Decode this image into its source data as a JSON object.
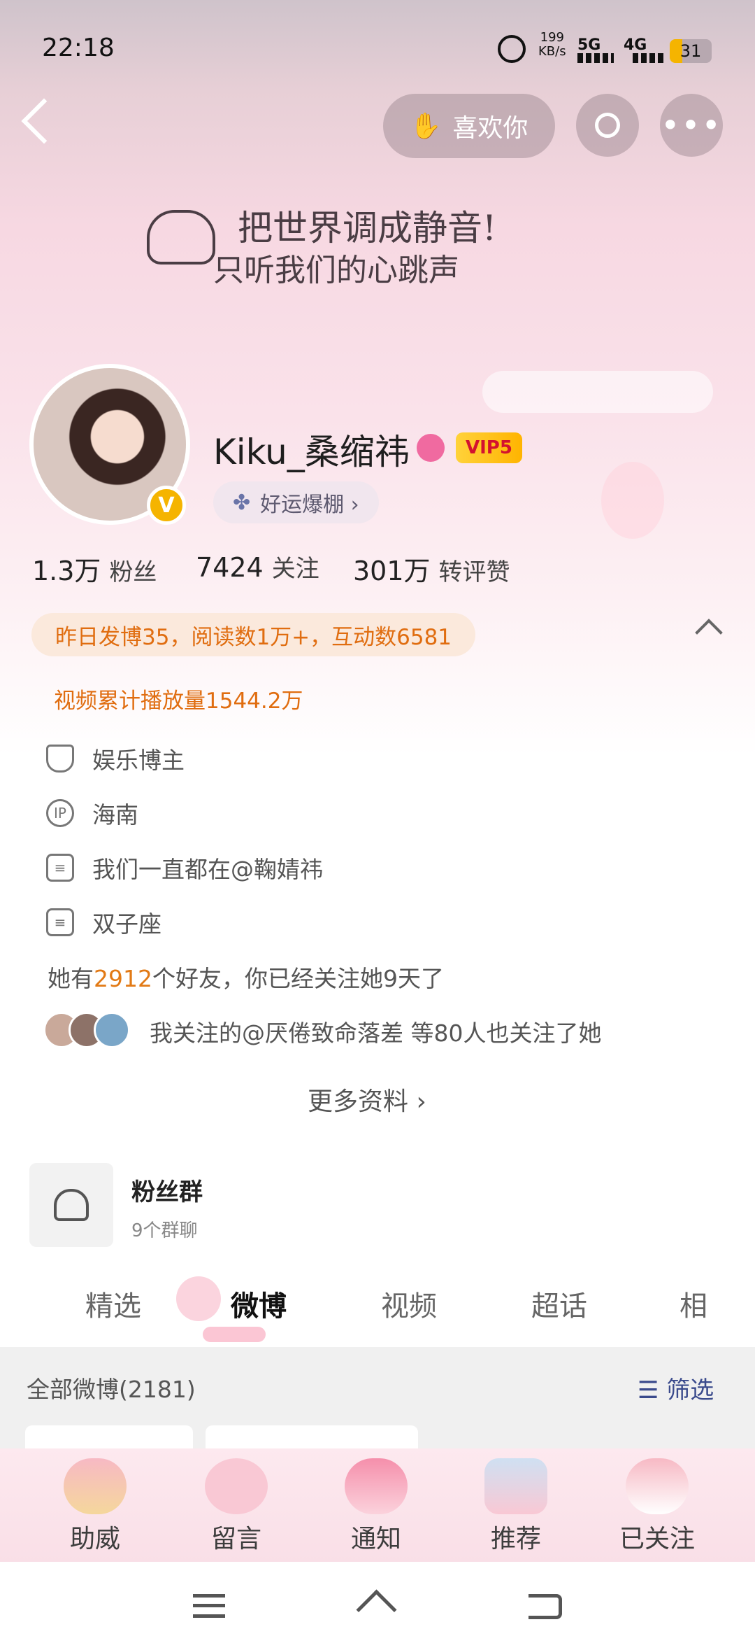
{
  "status": {
    "time": "22:18",
    "net_speed_top": "199",
    "net_speed_unit": "KB/s",
    "signal1": "5G",
    "signal2": "4G",
    "battery": "31"
  },
  "header": {
    "like_label": "喜欢你"
  },
  "banner": {
    "line1": "把世界调成静音!",
    "line2": "只听我们的心跳声"
  },
  "profile": {
    "name": "Kiku_桑缩祎",
    "vip": "VIP5",
    "luck_label": "好运爆棚 ›",
    "verified_badge": "V",
    "stats": [
      {
        "value": "1.3万",
        "label": "粉丝"
      },
      {
        "value": "7424",
        "label": "关注"
      },
      {
        "value": "301万",
        "label": "转评赞"
      }
    ],
    "yesterday": "昨日发博35，阅读数1万+，互动数6581",
    "video_plays": "视频累计播放量1544.2万",
    "info": [
      {
        "icon": "shield-icon",
        "text": "娱乐博主"
      },
      {
        "icon": "ip-icon",
        "text": "海南"
      },
      {
        "icon": "document-icon",
        "text": "我们一直都在@鞠婧祎"
      },
      {
        "icon": "calendar-icon",
        "text": "双子座"
      }
    ],
    "friends_prefix": "她有",
    "friends_count": "2912",
    "friends_suffix": "个好友，你已经关注她9天了",
    "mutual": "我关注的@厌倦致命落差 等80人也关注了她",
    "more": "更多资料 ›"
  },
  "fan_group": {
    "title": "粉丝群",
    "subtitle": "9个群聊"
  },
  "tabs": [
    "精选",
    "微博",
    "视频",
    "超话",
    "相"
  ],
  "feed": {
    "all_label": "全部微博(2181)",
    "filter_label": "筛选"
  },
  "bottom_bar": [
    "助威",
    "留言",
    "通知",
    "推荐",
    "已关注"
  ],
  "colors": {
    "accent": "#e27a16",
    "vip": "#f5a300",
    "tab_active": "#111111"
  }
}
